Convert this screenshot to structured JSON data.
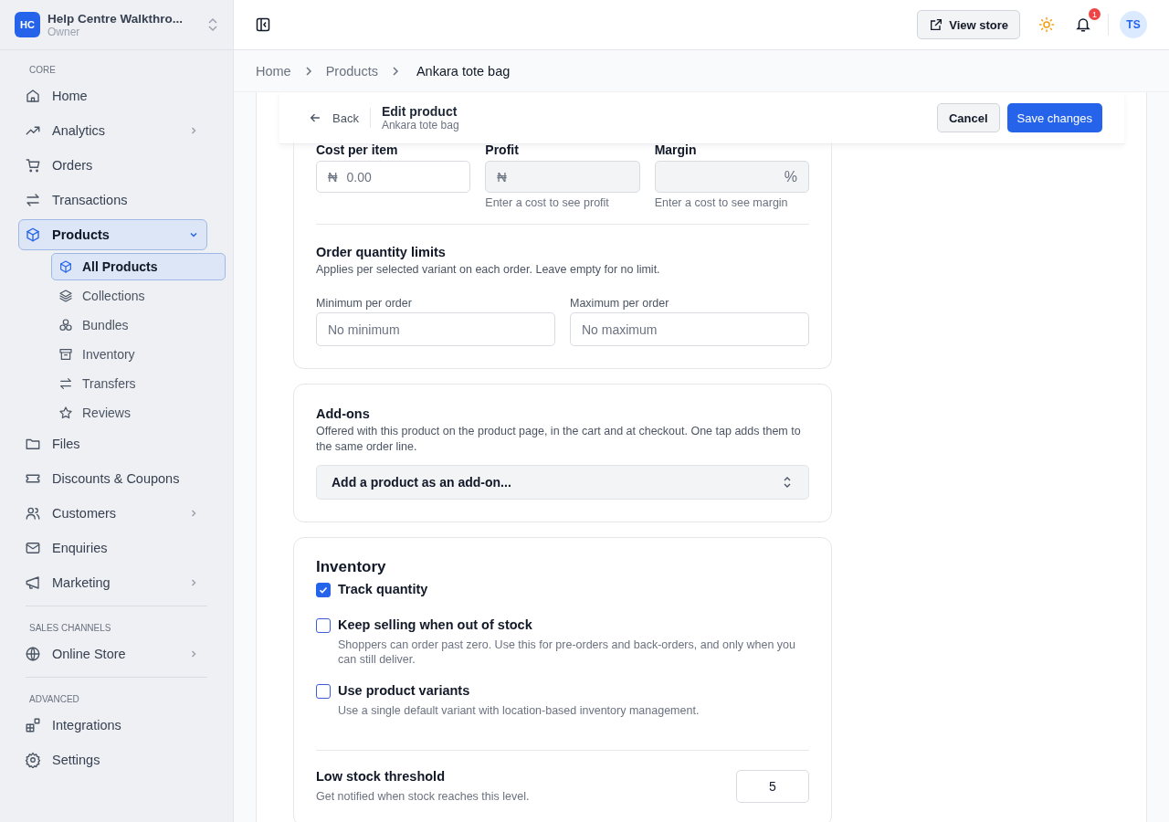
{
  "workspace": {
    "badge": "HC",
    "name": "Help Centre Walkthro...",
    "role": "Owner"
  },
  "sidebar": {
    "sections": [
      {
        "label": "CORE",
        "items": [
          {
            "label": "Home",
            "selected": false
          },
          {
            "label": "Analytics",
            "selected": false,
            "expanded": false
          },
          {
            "label": "Orders",
            "selected": false
          },
          {
            "label": "Transactions",
            "selected": false
          },
          {
            "label": "Products",
            "selected": true,
            "expanded": true,
            "children": [
              {
                "label": "All Products",
                "selected": true
              },
              {
                "label": "Collections",
                "selected": false
              },
              {
                "label": "Bundles",
                "selected": false
              },
              {
                "label": "Inventory",
                "selected": false
              },
              {
                "label": "Transfers",
                "selected": false
              },
              {
                "label": "Reviews",
                "selected": false
              }
            ]
          },
          {
            "label": "Files",
            "selected": false
          },
          {
            "label": "Discounts & Coupons",
            "selected": false
          },
          {
            "label": "Customers",
            "selected": false,
            "expanded": false
          },
          {
            "label": "Enquiries",
            "selected": false
          },
          {
            "label": "Marketing",
            "selected": false,
            "expanded": false
          }
        ]
      },
      {
        "label": "SALES CHANNELS",
        "items": [
          {
            "label": "Online Store",
            "selected": false,
            "expanded": false
          }
        ]
      },
      {
        "label": "ADVANCED",
        "items": [
          {
            "label": "Integrations",
            "selected": false
          },
          {
            "label": "Settings",
            "selected": false
          }
        ]
      }
    ]
  },
  "header": {
    "view_store": "View store",
    "notification_count": "1",
    "avatar": "TS"
  },
  "breadcrumb": [
    "Home",
    "Products",
    "Ankara tote bag"
  ],
  "edit_bar": {
    "back": "Back",
    "title": "Edit product",
    "subtitle": "Ankara tote bag",
    "cancel": "Cancel",
    "save": "Save changes"
  },
  "pricing": {
    "fields": [
      {
        "label": "Cost per item",
        "prefix": "₦",
        "placeholder": "0.00",
        "disabled": false
      },
      {
        "label": "Profit",
        "prefix": "₦",
        "hint": "Enter a cost to see profit",
        "disabled": true
      },
      {
        "label": "Margin",
        "suffix": "%",
        "hint": "Enter a cost to see margin",
        "disabled": true
      }
    ]
  },
  "order_limits": {
    "title": "Order quantity limits",
    "description": "Applies per selected variant on each order. Leave empty for no limit.",
    "fields": [
      {
        "label": "Minimum per order",
        "placeholder": "No minimum"
      },
      {
        "label": "Maximum per order",
        "placeholder": "No maximum"
      }
    ]
  },
  "addons": {
    "title": "Add-ons",
    "description": "Offered with this product on the product page, in the cart and at checkout. One tap adds them to the same order line.",
    "select": "Add a product as an add-on..."
  },
  "inventory": {
    "title": "Inventory",
    "options": [
      {
        "label": "Track quantity",
        "checked": true
      },
      {
        "label": "Keep selling when out of stock",
        "description": "Shoppers can order past zero. Use this for pre-orders and back-orders, and only when you can still deliver.",
        "checked": false
      },
      {
        "label": "Use product variants",
        "description": "Use a single default variant with location-based inventory management.",
        "checked": false
      }
    ],
    "threshold": {
      "label": "Low stock threshold",
      "description": "Get notified when stock reaches this level.",
      "value": "5"
    }
  }
}
